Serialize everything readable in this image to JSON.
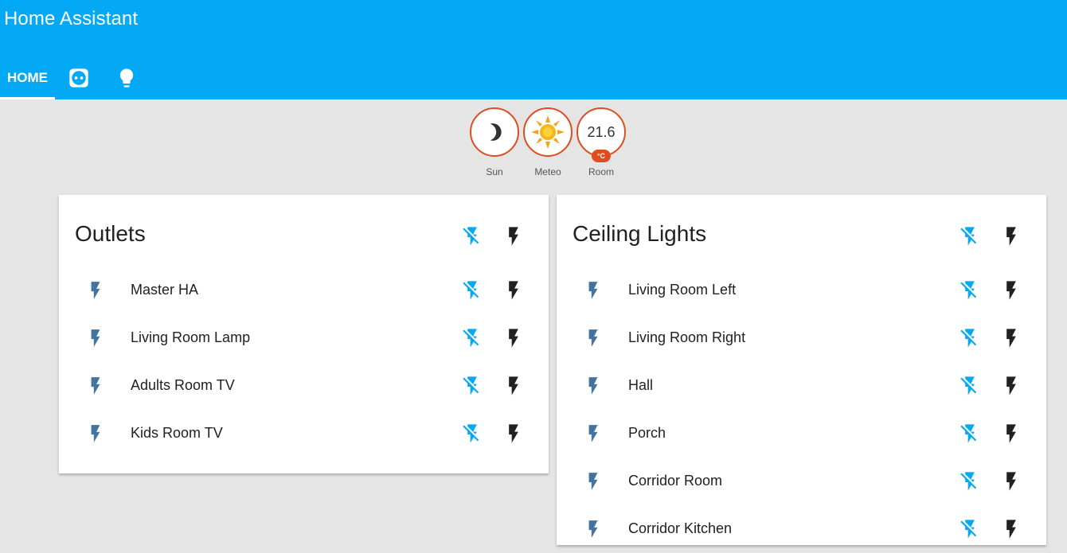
{
  "app": {
    "title": "Home Assistant"
  },
  "tabs": {
    "home": "HOME"
  },
  "badges": [
    {
      "label": "Sun",
      "icon": "moon-icon"
    },
    {
      "label": "Meteo",
      "icon": "sun-icon"
    },
    {
      "label": "Room",
      "value": "21.6",
      "unit": "°C"
    }
  ],
  "cards": {
    "outlets": {
      "title": "Outlets",
      "items": [
        "Master HA",
        "Living Room Lamp",
        "Adults Room TV",
        "Kids Room TV"
      ]
    },
    "ceiling": {
      "title": "Ceiling Lights",
      "items": [
        "Living Room Left",
        "Living Room Right",
        "Hall",
        "Porch",
        "Corridor Room",
        "Corridor Kitchen"
      ]
    }
  },
  "colors": {
    "header": "#03a9f4",
    "badge_border": "#df4c1e",
    "state_icon": "#44739e",
    "off_button": "#03a9f4",
    "on_button": "#212121"
  }
}
